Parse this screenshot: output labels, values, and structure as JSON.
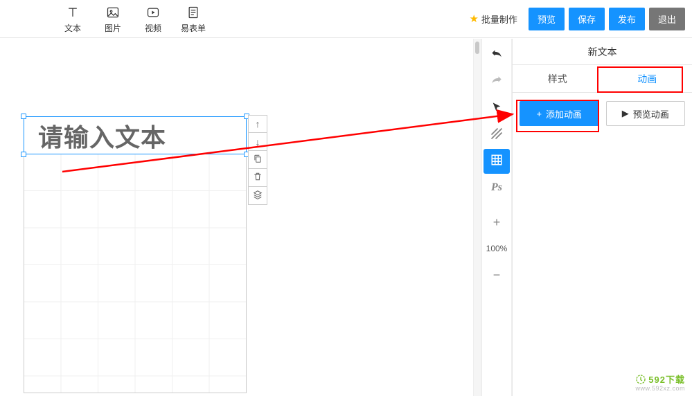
{
  "topbar": {
    "tools": [
      {
        "label": "文本",
        "icon": "text-icon"
      },
      {
        "label": "图片",
        "icon": "image-icon"
      },
      {
        "label": "视频",
        "icon": "video-icon"
      },
      {
        "label": "易表单",
        "icon": "form-icon"
      }
    ],
    "batch_label": "批量制作",
    "preview": "预览",
    "save": "保存",
    "publish": "发布",
    "exit": "退出"
  },
  "canvas": {
    "text_placeholder": "请输入文本"
  },
  "vtoolbar": {
    "zoom": "100%"
  },
  "panel": {
    "title": "新文本",
    "tabs": {
      "style": "样式",
      "animation": "动画"
    },
    "add_animation": "添加动画",
    "preview_animation": "预览动画"
  },
  "watermark": {
    "brand": "592下载",
    "url": "www.592xz.com"
  }
}
